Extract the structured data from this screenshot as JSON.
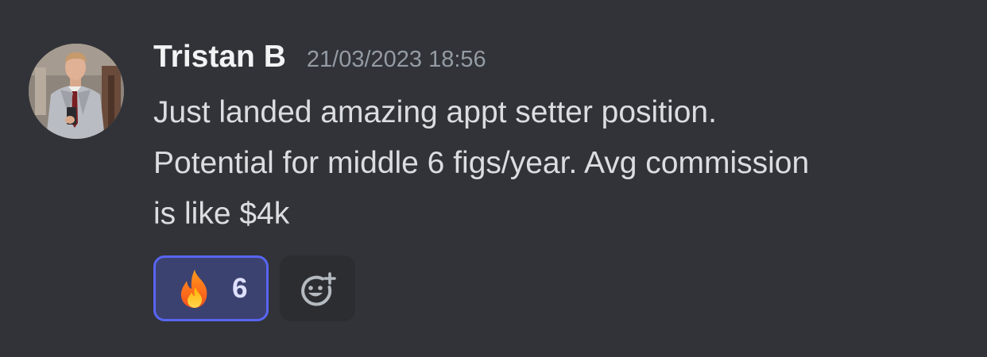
{
  "message": {
    "author": "Tristan B",
    "timestamp": "21/03/2023 18:56",
    "lines": [
      "Just landed amazing appt setter position.",
      "Potential for middle 6 figs/year. Avg commission",
      "is like $4k"
    ]
  },
  "reactions": [
    {
      "emoji": "fire-icon",
      "count": "6",
      "reacted_by_me": true
    }
  ],
  "add_reaction": {
    "icon": "add-reaction-icon"
  },
  "colors": {
    "background": "#313338",
    "username": "#f2f3f5",
    "timestamp": "#949ba4",
    "text": "#dbdee1",
    "reaction_active_bg": "#3c4270",
    "reaction_active_border": "#5865f2"
  }
}
